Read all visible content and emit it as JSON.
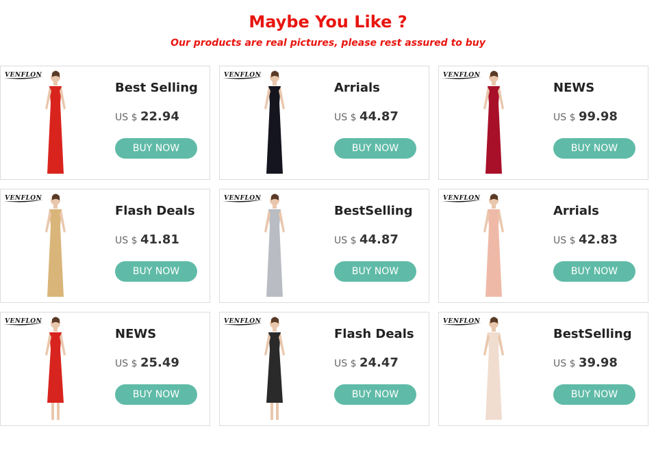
{
  "header": {
    "title": "Maybe You Like ?",
    "subtitle": "Our products are real pictures, please rest assured to buy"
  },
  "brand": "VENFLON",
  "colors": {
    "accent": "#e8150f",
    "button": "#5fbba7"
  },
  "products": [
    {
      "name": "Best Selling",
      "currency": "US $",
      "price": "22.94",
      "button": "BUY NOW",
      "dress_color": "#d9241e",
      "icon": "red-gown-image"
    },
    {
      "name": "Arrials",
      "currency": "US $",
      "price": "44.87",
      "button": "BUY NOW",
      "dress_color": "#15151f",
      "icon": "black-gown-image"
    },
    {
      "name": "NEWS",
      "currency": "US $",
      "price": "99.98",
      "button": "BUY NOW",
      "dress_color": "#a8102a",
      "icon": "burgundy-gown-image"
    },
    {
      "name": "Flash Deals",
      "currency": "US $",
      "price": "41.81",
      "button": "BUY NOW",
      "dress_color": "#d9b57a",
      "icon": "gold-gown-image"
    },
    {
      "name": "BestSelling",
      "currency": "US $",
      "price": "44.87",
      "button": "BUY NOW",
      "dress_color": "#b9bcc2",
      "icon": "silver-gown-image"
    },
    {
      "name": "Arrials",
      "currency": "US $",
      "price": "42.83",
      "button": "BUY NOW",
      "dress_color": "#efb9a8",
      "icon": "pink-gown-image"
    },
    {
      "name": "NEWS",
      "currency": "US $",
      "price": "25.49",
      "button": "BUY NOW",
      "dress_color": "#d8241f",
      "icon": "red-lace-dress-image"
    },
    {
      "name": "Flash Deals",
      "currency": "US $",
      "price": "24.47",
      "button": "BUY NOW",
      "dress_color": "#2a2a2a",
      "icon": "fringe-dress-image"
    },
    {
      "name": "BestSelling",
      "currency": "US $",
      "price": "39.98",
      "button": "BUY NOW",
      "dress_color": "#f0ddd0",
      "icon": "ivory-gown-image"
    }
  ]
}
